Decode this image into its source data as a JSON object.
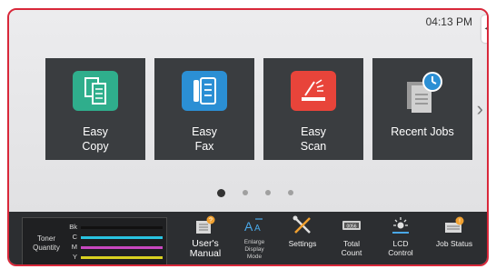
{
  "status": {
    "time": "04:13 PM",
    "side_tab_icon": "chevron-left-icon"
  },
  "tiles": [
    {
      "label": "Easy\nCopy",
      "icon": "copy-icon",
      "color": "#2fae8c"
    },
    {
      "label": "Easy\nFax",
      "icon": "fax-icon",
      "color": "#2b8fd4"
    },
    {
      "label": "Easy\nScan",
      "icon": "scan-icon",
      "color": "#e8443a"
    },
    {
      "label": "Recent Jobs",
      "icon": "recent-jobs-icon",
      "color": "#e8e8e8"
    }
  ],
  "navigation": {
    "next_icon": "chevron-right-icon",
    "pages": 4,
    "current_page": 1
  },
  "toner": {
    "title": "Toner\nQuantity",
    "levels": [
      {
        "key": "Bk",
        "color": "#111111"
      },
      {
        "key": "C",
        "color": "#29c3e0"
      },
      {
        "key": "M",
        "color": "#c848c0"
      },
      {
        "key": "Y",
        "color": "#d8d020"
      }
    ]
  },
  "bottom_items": [
    {
      "label": "User's\nManual",
      "icon": "users-manual-icon",
      "style": "big"
    },
    {
      "label": "Enlarge\nDisplay\nMode",
      "icon": "enlarge-display-icon",
      "style": "small"
    },
    {
      "label": "Settings",
      "icon": "settings-icon",
      "style": "normal"
    },
    {
      "label": "Total\nCount",
      "icon": "total-count-icon",
      "style": "normal"
    },
    {
      "label": "LCD\nControl",
      "icon": "lcd-control-icon",
      "style": "normal"
    },
    {
      "label": "Job Status",
      "icon": "job-status-icon",
      "style": "normal"
    }
  ],
  "accent": "#d8283a"
}
